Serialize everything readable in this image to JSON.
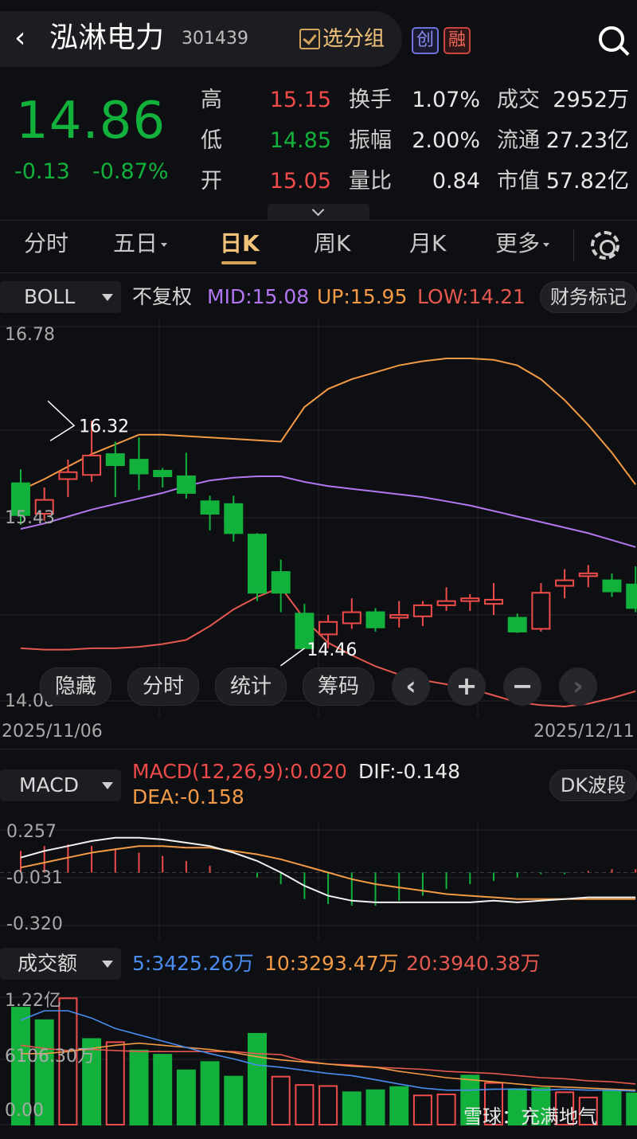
{
  "header": {
    "back_glyph": "‹",
    "stock_name": "泓淋电力",
    "stock_code": "301439",
    "select_group": "选分组",
    "badge_chuang": "创",
    "badge_rong": "融"
  },
  "quote": {
    "price": "14.86",
    "change": "-0.13",
    "change_pct": "-0.87%",
    "rows": [
      {
        "l1": "高",
        "v1": "15.15",
        "l2": "换手",
        "v2": "1.07%",
        "l3": "成交",
        "v3": "2952万"
      },
      {
        "l1": "低",
        "v1": "14.85",
        "l2": "振幅",
        "v2": "2.00%",
        "l3": "流通",
        "v3": "27.23亿"
      },
      {
        "l1": "开",
        "v1": "15.05",
        "l2": "量比",
        "v2": "0.84",
        "l3": "市值",
        "v3": "57.82亿"
      }
    ]
  },
  "tabs": [
    "分时",
    "五日",
    "日K",
    "周K",
    "月K",
    "更多"
  ],
  "boll": {
    "indicator": "BOLL",
    "fq": "不复权",
    "mid": "MID:15.08",
    "up": "UP:15.95",
    "low": "LOW:14.21",
    "fin_mark": "财务标记",
    "y_top": "16.78",
    "y_mid": "15.43",
    "y_bot": "14.08",
    "date_start": "2025/11/06",
    "date_end": "2025/12/11",
    "max_label": "16.32",
    "min_label": "14.46"
  },
  "kbuttons": {
    "hide": "隐藏",
    "timeshare": "分时",
    "stats": "统计",
    "chips": "筹码",
    "prev": "‹",
    "zoom_in": "+",
    "zoom_out": "−",
    "next": "›"
  },
  "macd": {
    "indicator": "MACD",
    "title": "MACD(12,26,9):0.020",
    "dif": "DIF:-0.148",
    "dea": "DEA:-0.158",
    "dk": "DK波段",
    "y_top": "0.257",
    "y_mid": "-0.031",
    "y_bot": "-0.320"
  },
  "vol": {
    "indicator": "成交额",
    "ma5": "5:3425.26万",
    "ma10": "10:3293.47万",
    "ma20": "20:3940.38万",
    "y_top": "1.22亿",
    "y_mid": "6106.30万",
    "y_bot": "0.00"
  },
  "watermark": "雪球：充满地气",
  "colors": {
    "up": "#ef4b4b",
    "down": "#12b13c",
    "mid": "#b277f0",
    "upper": "#f39a45",
    "lower": "#e5584f",
    "accent": "#f0c27a"
  },
  "chart_data": [
    {
      "type": "candlestick",
      "title": "BOLL",
      "price_range": [
        14.08,
        16.78
      ],
      "candles": [
        {
          "o": 15.65,
          "c": 15.42,
          "h": 15.75,
          "l": 15.35
        },
        {
          "o": 15.43,
          "c": 15.53,
          "h": 15.62,
          "l": 15.38
        },
        {
          "o": 15.68,
          "c": 15.73,
          "h": 15.82,
          "l": 15.55
        },
        {
          "o": 15.71,
          "c": 15.85,
          "h": 16.1,
          "l": 15.66
        },
        {
          "o": 15.86,
          "c": 15.78,
          "h": 15.95,
          "l": 15.55
        },
        {
          "o": 15.82,
          "c": 15.72,
          "h": 15.98,
          "l": 15.6
        },
        {
          "o": 15.74,
          "c": 15.7,
          "h": 15.76,
          "l": 15.62
        },
        {
          "o": 15.7,
          "c": 15.58,
          "h": 15.87,
          "l": 15.54
        },
        {
          "o": 15.52,
          "c": 15.43,
          "h": 15.56,
          "l": 15.31
        },
        {
          "o": 15.5,
          "c": 15.29,
          "h": 15.56,
          "l": 15.23
        },
        {
          "o": 15.28,
          "c": 14.86,
          "h": 15.29,
          "l": 14.8
        },
        {
          "o": 15.01,
          "c": 14.86,
          "h": 15.1,
          "l": 14.72
        },
        {
          "o": 14.71,
          "c": 14.46,
          "h": 14.78,
          "l": 14.46
        },
        {
          "o": 14.56,
          "c": 14.65,
          "h": 14.7,
          "l": 14.46
        },
        {
          "o": 14.64,
          "c": 14.72,
          "h": 14.82,
          "l": 14.6
        },
        {
          "o": 14.72,
          "c": 14.61,
          "h": 14.75,
          "l": 14.58
        },
        {
          "o": 14.68,
          "c": 14.7,
          "h": 14.8,
          "l": 14.61
        },
        {
          "o": 14.69,
          "c": 14.77,
          "h": 14.8,
          "l": 14.62
        },
        {
          "o": 14.77,
          "c": 14.8,
          "h": 14.9,
          "l": 14.73
        },
        {
          "o": 14.8,
          "c": 14.82,
          "h": 14.85,
          "l": 14.73
        },
        {
          "o": 14.78,
          "c": 14.81,
          "h": 14.93,
          "l": 14.7
        },
        {
          "o": 14.68,
          "c": 14.58,
          "h": 14.71,
          "l": 14.57
        },
        {
          "o": 14.6,
          "c": 14.86,
          "h": 14.93,
          "l": 14.58
        },
        {
          "o": 14.91,
          "c": 14.95,
          "h": 15.03,
          "l": 14.82
        },
        {
          "o": 14.98,
          "c": 15.0,
          "h": 15.06,
          "l": 14.9
        },
        {
          "o": 14.95,
          "c": 14.87,
          "h": 15.0,
          "l": 14.83
        },
        {
          "o": 14.92,
          "c": 14.75,
          "h": 15.05,
          "l": 14.72
        }
      ],
      "mid_series": [
        15.32,
        15.36,
        15.41,
        15.46,
        15.5,
        15.54,
        15.58,
        15.63,
        15.67,
        15.69,
        15.7,
        15.7,
        15.66,
        15.63,
        15.61,
        15.59,
        15.57,
        15.55,
        15.52,
        15.49,
        15.45,
        15.41,
        15.37,
        15.33,
        15.29,
        15.24,
        15.19
      ],
      "upper_series": [
        15.6,
        15.68,
        15.77,
        15.86,
        15.93,
        16.0,
        16.0,
        15.99,
        15.98,
        15.97,
        15.96,
        15.95,
        16.2,
        16.33,
        16.4,
        16.45,
        16.5,
        16.53,
        16.55,
        16.55,
        16.54,
        16.5,
        16.4,
        16.25,
        16.07,
        15.87,
        15.64
      ],
      "lower_series": [
        14.46,
        14.45,
        14.45,
        14.46,
        14.46,
        14.47,
        14.49,
        14.52,
        14.62,
        14.74,
        14.83,
        14.9,
        14.67,
        14.5,
        14.41,
        14.33,
        14.27,
        14.23,
        14.2,
        14.17,
        14.12,
        14.07,
        14.05,
        14.04,
        14.06,
        14.1,
        14.15
      ]
    },
    {
      "type": "bar+line",
      "title": "MACD(12,26,9)",
      "value_range": [
        -0.32,
        0.257
      ],
      "hist": [
        0.13,
        0.16,
        0.17,
        0.16,
        0.14,
        0.12,
        0.1,
        0.07,
        0.04,
        0.0,
        -0.03,
        -0.07,
        -0.16,
        -0.19,
        -0.2,
        -0.2,
        -0.17,
        -0.14,
        -0.1,
        -0.07,
        -0.05,
        -0.03,
        -0.01,
        -0.01,
        0.01,
        0.02,
        0.02
      ],
      "dif": [
        0.09,
        0.13,
        0.16,
        0.19,
        0.21,
        0.21,
        0.2,
        0.18,
        0.16,
        0.12,
        0.07,
        0.0,
        -0.08,
        -0.14,
        -0.17,
        -0.18,
        -0.18,
        -0.18,
        -0.18,
        -0.18,
        -0.17,
        -0.18,
        -0.17,
        -0.16,
        -0.15,
        -0.15,
        -0.15
      ],
      "dea": [
        0.03,
        0.06,
        0.09,
        0.12,
        0.14,
        0.16,
        0.16,
        0.15,
        0.15,
        0.13,
        0.11,
        0.08,
        0.04,
        0.0,
        -0.04,
        -0.07,
        -0.09,
        -0.11,
        -0.13,
        -0.14,
        -0.15,
        -0.16,
        -0.16,
        -0.16,
        -0.16,
        -0.16,
        -0.16
      ]
    },
    {
      "type": "bar+line",
      "title": "成交额",
      "value_range": [
        0,
        1.22
      ],
      "unit": "亿",
      "volume": [
        1.12,
        1.0,
        1.21,
        0.82,
        0.79,
        0.71,
        0.67,
        0.52,
        0.6,
        0.46,
        0.87,
        0.46,
        0.38,
        0.37,
        0.31,
        0.33,
        0.36,
        0.28,
        0.29,
        0.47,
        0.4,
        0.34,
        0.35,
        0.31,
        0.26,
        0.33,
        0.3
      ],
      "vol_up": [
        false,
        false,
        true,
        false,
        true,
        false,
        false,
        false,
        false,
        false,
        false,
        true,
        true,
        true,
        false,
        false,
        false,
        true,
        true,
        false,
        true,
        false,
        false,
        true,
        true,
        false,
        false
      ],
      "ma5": [
        1.0,
        1.09,
        1.09,
        1.02,
        0.92,
        0.86,
        0.8,
        0.74,
        0.68,
        0.63,
        0.57,
        0.55,
        0.52,
        0.49,
        0.47,
        0.43,
        0.39,
        0.35,
        0.33,
        0.33,
        0.34,
        0.34,
        0.33,
        0.34,
        0.33,
        0.33,
        0.32
      ],
      "ma10": [
        0.68,
        0.68,
        0.7,
        0.73,
        0.76,
        0.78,
        0.76,
        0.74,
        0.72,
        0.69,
        0.65,
        0.62,
        0.6,
        0.58,
        0.56,
        0.55,
        0.51,
        0.48,
        0.45,
        0.43,
        0.41,
        0.39,
        0.37,
        0.36,
        0.35,
        0.34,
        0.33
      ],
      "ma20": [
        0.76,
        0.73,
        0.71,
        0.72,
        0.71,
        0.7,
        0.7,
        0.7,
        0.7,
        0.7,
        0.68,
        0.67,
        0.61,
        0.58,
        0.57,
        0.55,
        0.54,
        0.53,
        0.51,
        0.5,
        0.49,
        0.47,
        0.45,
        0.44,
        0.42,
        0.41,
        0.39
      ]
    }
  ]
}
